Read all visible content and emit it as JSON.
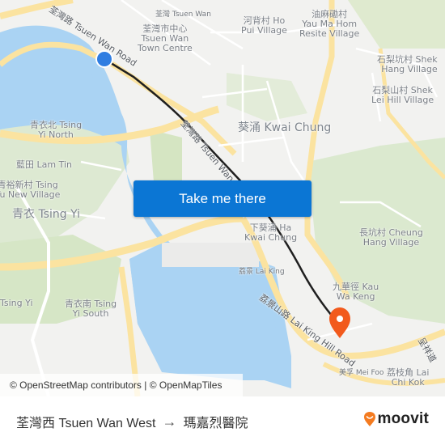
{
  "map": {
    "labels": {
      "tsuen_wan": "荃灣 Tsuen Wan",
      "tsuen_wan_centre_cn": "荃灣市中心",
      "tsuen_wan_centre_en1": "Tsuen Wan",
      "tsuen_wan_centre_en2": "Town Centre",
      "ho_pui_1": "河背村 Ho",
      "ho_pui_2": "Pui Village",
      "yau_ma_hom_cn": "油麻磡村",
      "yau_ma_hom_en1": "Yau Ma Hom",
      "yau_ma_hom_en2": "Resite Village",
      "shek_hang_1": "石梨坑村 Shek",
      "shek_hang_2": "Hang Village",
      "shek_lei_1": "石梨山村 Shek",
      "shek_lei_2": "Lei Hill Village",
      "kwai_chung": "葵涌 Kwai Chung",
      "tsing_yi_north_1": "青衣北 Tsing",
      "tsing_yi_north_2": "Yi North",
      "lam_tin": "藍田 Lam Tin",
      "tsing_yu_1": "青裕新村 Tsing",
      "tsing_yu_2": "Yu New Village",
      "tsing_yi": "青衣 Tsing Yi",
      "ha_kwai_chung_1": "下葵涌 Ha",
      "ha_kwai_chung_2": "Kwai Chung",
      "lai_king": "荔景 Lai King",
      "cheung_hang_1": "長坑村 Cheung",
      "cheung_hang_2": "Hang Village",
      "kau_wa_keng_1": "九華徑 Kau",
      "kau_wa_keng_2": "Wa Keng",
      "tsing_yi_west": "Tsing Yi",
      "tsing_yi_south_1": "青衣南 Tsing",
      "tsing_yi_south_2": "Yi South",
      "mei_foo": "美孚 Mei Foo",
      "lai_chi_kok_1": "荔枝角 Lai",
      "lai_chi_kok_2": "Chi Kok"
    },
    "roads": {
      "tsuen_wan_road_top": "荃灣路 Tsuen Wan Road",
      "tsuen_wan_road_mid": "荃灣路 Tsuen Wan",
      "lai_king_hill_road": "荔景山路 Lai King Hill Road",
      "east_road": "呈祥道"
    },
    "attribution": "© OpenStreetMap contributors | © OpenMapTiles",
    "colors": {
      "water": "#aad3f3",
      "land": "#f2f2f0",
      "park": "#d8e8c8",
      "major_road": "#fbe3a0",
      "route_line": "#1f1f1f",
      "origin_marker": "#2f7de1",
      "destination_marker": "#f25a1c"
    }
  },
  "cta": {
    "label": "Take me there"
  },
  "footer": {
    "origin": "荃灣西 Tsuen Wan West",
    "arrow": "→",
    "destination": "瑪嘉烈醫院",
    "brand": "moovit",
    "brand_color": "#f47b20"
  }
}
